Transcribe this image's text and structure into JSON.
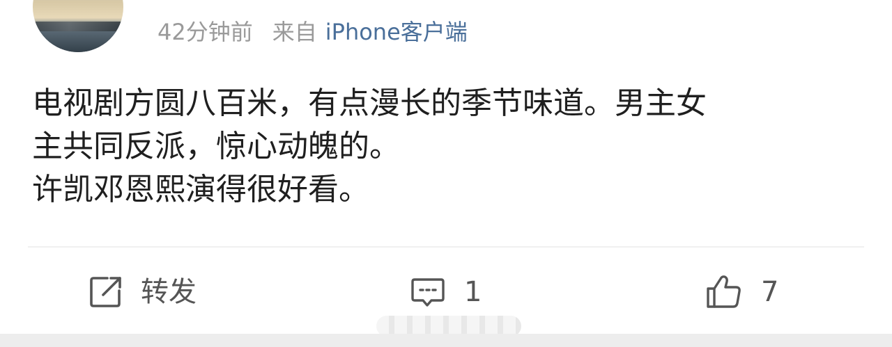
{
  "post": {
    "time": "42分钟前",
    "source_label": "来自",
    "source_name": "iPhone客户端",
    "lines": [
      "电视剧方圆八百米，有点漫长的季节味道。男主女",
      "主共同反派，惊心动魄的。",
      "许凯邓恩熙演得很好看。"
    ]
  },
  "actions": {
    "repost_label": "转发",
    "comment_count": "1",
    "like_count": "7"
  },
  "icons": {
    "repost": "share-icon",
    "comment": "comment-icon",
    "like": "thumbs-up-icon"
  },
  "colors": {
    "source_link": "#4a6f9a",
    "meta_text": "#9a9a9a",
    "body_text": "#1f1f1f",
    "action_text": "#555555"
  }
}
